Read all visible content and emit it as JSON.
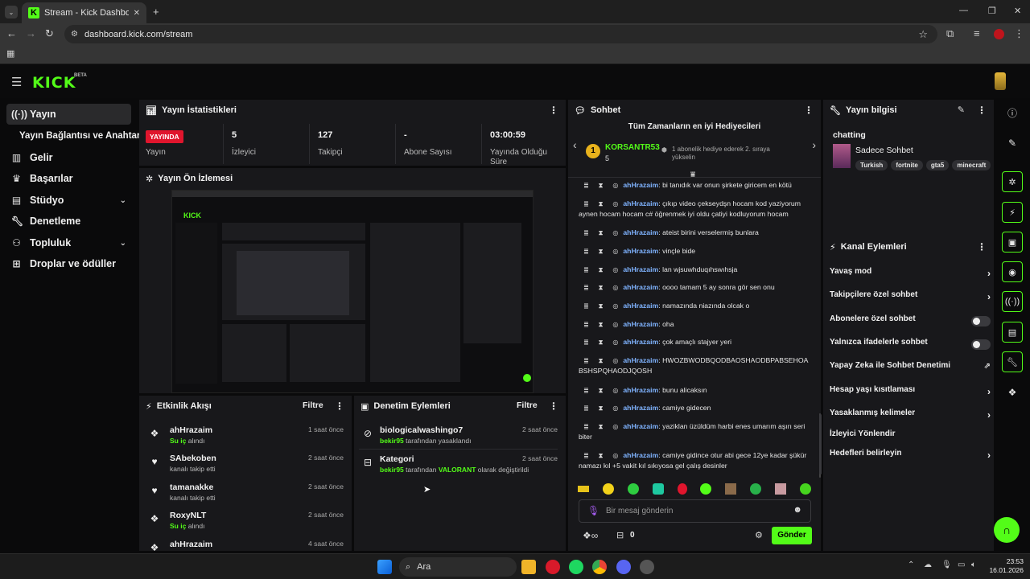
{
  "browser": {
    "tab_title": "Stream - Kick Dashboard",
    "url": "dashboard.kick.com/stream"
  },
  "app": {
    "logo": "KICK",
    "beta": "BETA"
  },
  "sidebar": {
    "items": [
      {
        "label": "Yayın",
        "icon": "broadcast-icon"
      },
      {
        "label": "Yayın Bağlantısı ve Anahtarı"
      },
      {
        "label": "Gelir",
        "icon": "chart-icon"
      },
      {
        "label": "Başarılar",
        "icon": "trophy-icon"
      },
      {
        "label": "Stüdyo",
        "icon": "studio-icon"
      },
      {
        "label": "Denetleme",
        "icon": "wrench-icon"
      },
      {
        "label": "Topluluk",
        "icon": "community-icon"
      },
      {
        "label": "Droplar ve ödüller",
        "icon": "gift-icon"
      }
    ]
  },
  "stats": {
    "title": "Yayın İstatistikleri",
    "live_badge": "YAYINDA",
    "live_label": "Yayın",
    "cells": [
      {
        "value": "5",
        "label": "İzleyici"
      },
      {
        "value": "127",
        "label": "Takipçi"
      },
      {
        "value": "-",
        "label": "Abone Sayısı"
      },
      {
        "value": "03:00:59",
        "label": "Yayında Olduğu Süre"
      }
    ]
  },
  "preview": {
    "title": "Yayın Ön İzlemesi"
  },
  "activity": {
    "title": "Etkinlik Akışı",
    "filter": "Filtre",
    "items": [
      {
        "name": "ahHrazaim",
        "sub_green": "Su iç",
        "sub": "alındı",
        "time": "1 saat önce",
        "icon": "redeem-icon"
      },
      {
        "name": "SAbekoben",
        "sub_green": "",
        "sub": "kanalı takip etti",
        "time": "2 saat önce",
        "icon": "heart-icon"
      },
      {
        "name": "tamanakke",
        "sub_green": "",
        "sub": "kanalı takip etti",
        "time": "2 saat önce",
        "icon": "heart-icon"
      },
      {
        "name": "RoxyNLT",
        "sub_green": "Su iç",
        "sub": "alındı",
        "time": "2 saat önce",
        "icon": "redeem-icon"
      },
      {
        "name": "ahHrazaim",
        "sub_green": "",
        "sub": "",
        "time": "4 saat önce",
        "icon": "redeem-icon"
      }
    ]
  },
  "moderation": {
    "title": "Denetim Eylemleri",
    "filter": "Filtre",
    "items": [
      {
        "name": "biologicalwashingo7",
        "actor": "bekir95",
        "text": "tarafından yasaklandı",
        "highlight": "",
        "tail": "",
        "time": "2 saat önce"
      },
      {
        "name": "Kategori",
        "actor": "bekir95",
        "text": "tarafından",
        "highlight": "VALORANT",
        "tail": "olarak değiştirildi",
        "time": "2 saat önce"
      }
    ]
  },
  "chat": {
    "title": "Sohbet",
    "gifters_title": "Tüm Zamanların en iyi Hediyecileri",
    "top_gifter": {
      "rank": "1",
      "name": "KORSANTR53",
      "count": "5"
    },
    "next_gifter_text": "1 abonelik hediye ederek 2. sıraya yükselin",
    "messages": [
      {
        "user": "ahHrazaim",
        "text": "bi tanıdık var onun şirkete giricem en kötü"
      },
      {
        "user": "ahHrazaim",
        "text": "çıkıp video çekseydşn hocam kod yaziyorum aynen hocam hocam c# öğrenmek iyi oldu çatiyi kodluyorum hocam"
      },
      {
        "user": "ahHrazaim",
        "text": "ateist birini verselermiş bunlara"
      },
      {
        "user": "ahHrazaim",
        "text": "vinçle bide"
      },
      {
        "user": "ahHrazaim",
        "text": "lan wjsuwhduqıhswıhsja"
      },
      {
        "user": "ahHrazaim",
        "text": "oooo tamam 5 ay sonra gör sen onu"
      },
      {
        "user": "ahHrazaim",
        "text": "namazında niazında olcak o"
      },
      {
        "user": "ahHrazaim",
        "text": "oha"
      },
      {
        "user": "ahHrazaim",
        "text": "çok amaçlı stajyer yeri"
      },
      {
        "user": "ahHrazaim",
        "text": "HWOZBWODBQODBAOSHAODBPABSEHOABSHSPQHAODJQOSH"
      },
      {
        "user": "ahHrazaim",
        "text": "bunu alicaksın"
      },
      {
        "user": "ahHrazaim",
        "text": "camiye gidecen"
      },
      {
        "user": "ahHrazaim",
        "text": "yaziklan üzüldüm harbi enes umarım aşırı seri biter"
      },
      {
        "user": "ahHrazaim",
        "text": "camiye gidince otur abi gece 12ye kadar şükür namazı kıl +5 vakit kıl sıkıyosa gel çalış desinler"
      }
    ],
    "input_placeholder": "Bir mesaj gönderin",
    "points": "0",
    "send_label": "Gönder"
  },
  "stream_info": {
    "title": "Yayın bilgisi",
    "stream_title": "chatting",
    "category": "Sadece Sohbet",
    "tags": [
      "Turkish",
      "fortnite",
      "gta5",
      "minecraft"
    ]
  },
  "channel_actions": {
    "title": "Kanal Eylemleri",
    "items": [
      {
        "label": "Yavaş mod",
        "control": "chevron"
      },
      {
        "label": "Takipçilere özel sohbet",
        "control": "chevron"
      },
      {
        "label": "Abonelere özel sohbet",
        "control": "toggle"
      },
      {
        "label": "Yalnızca ifadelerle sohbet",
        "control": "toggle"
      },
      {
        "label": "Yapay Zeka ile Sohbet Denetimi",
        "control": "external"
      },
      {
        "label": "Hesap yaşı kısıtlaması",
        "control": "chevron"
      },
      {
        "label": "Yasaklanmış kelimeler",
        "control": "chevron"
      },
      {
        "label": "İzleyici Yönlendir",
        "control": "none"
      },
      {
        "label": "Hedefleri belirleyin",
        "control": "chevron"
      }
    ]
  },
  "taskbar": {
    "search_label": "Ara",
    "time": "23:53",
    "date": "16.01.2026"
  },
  "colors": {
    "accent": "#53fc18",
    "live": "#e0152d",
    "panel": "#18181b",
    "username": "#7fb3ff"
  }
}
